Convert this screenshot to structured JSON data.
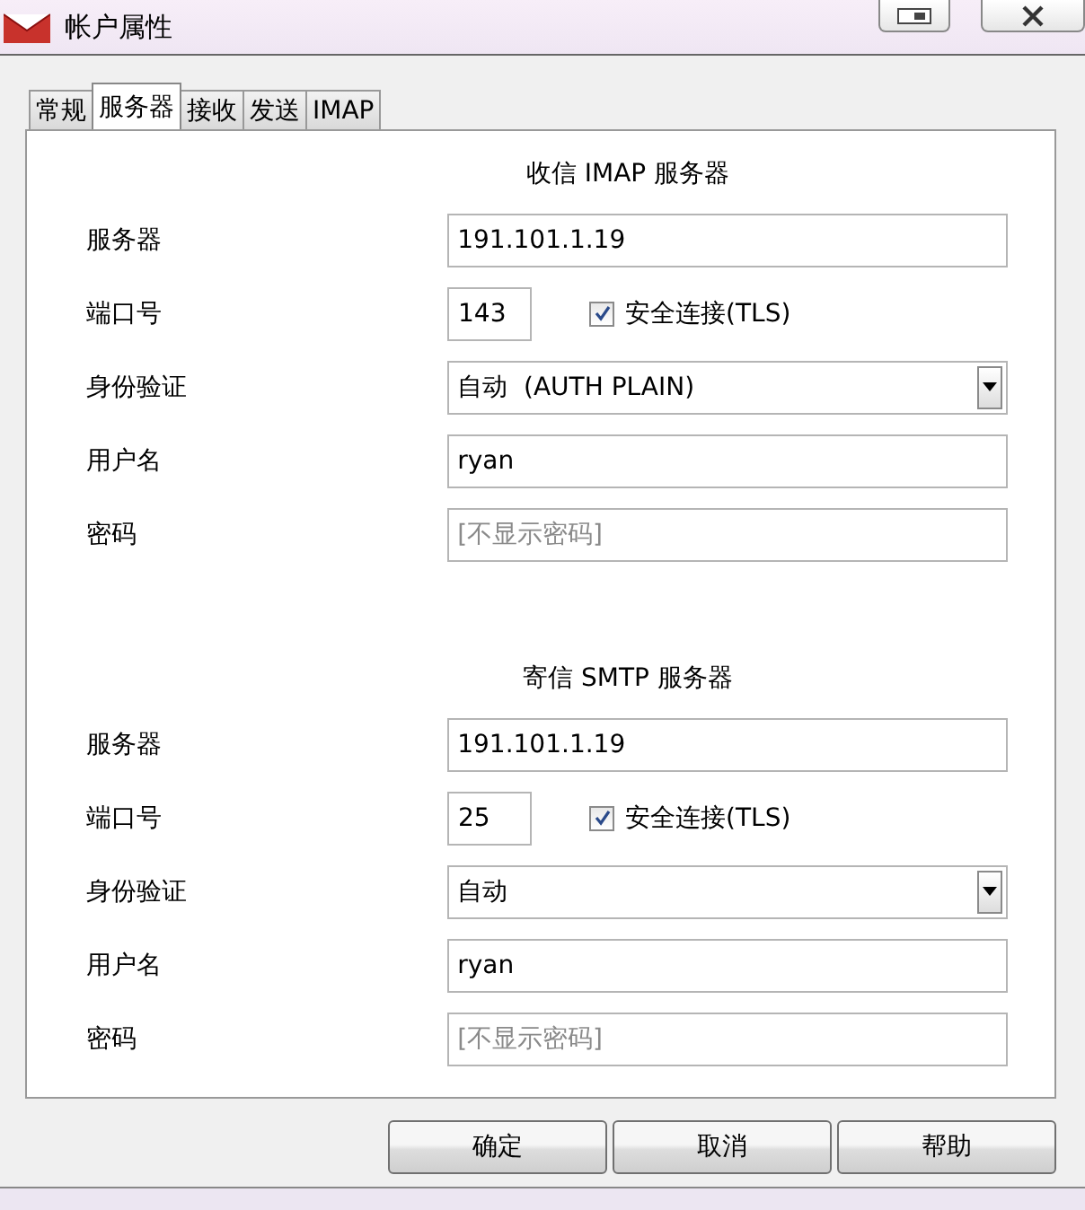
{
  "window": {
    "title": "帐户属性"
  },
  "tabs": [
    {
      "label": "常规",
      "selected": false
    },
    {
      "label": "服务器",
      "selected": true
    },
    {
      "label": "接收",
      "selected": false
    },
    {
      "label": "发送",
      "selected": false
    },
    {
      "label": "IMAP",
      "selected": false
    }
  ],
  "sections": [
    {
      "title": "收信 IMAP 服务器",
      "fields": [
        {
          "kind": "text",
          "label": "服务器",
          "value": "191.101.1.19"
        },
        {
          "kind": "port",
          "label": "端口号",
          "value": "143",
          "checkbox": {
            "label": "安全连接(TLS)",
            "checked": true
          }
        },
        {
          "kind": "select",
          "label": "身份验证",
          "value": "自动  (AUTH PLAIN)"
        },
        {
          "kind": "text",
          "label": "用户名",
          "value": "ryan"
        },
        {
          "kind": "password",
          "label": "密码",
          "placeholder": "[不显示密码]"
        }
      ]
    },
    {
      "title": "寄信 SMTP 服务器",
      "fields": [
        {
          "kind": "text",
          "label": "服务器",
          "value": "191.101.1.19"
        },
        {
          "kind": "port",
          "label": "端口号",
          "value": "25",
          "checkbox": {
            "label": "安全连接(TLS)",
            "checked": true
          }
        },
        {
          "kind": "select",
          "label": "身份验证",
          "value": "自动"
        },
        {
          "kind": "text",
          "label": "用户名",
          "value": "ryan"
        },
        {
          "kind": "password",
          "label": "密码",
          "placeholder": "[不显示密码]"
        }
      ]
    }
  ],
  "buttons": [
    "确定",
    "取消",
    "帮助"
  ]
}
